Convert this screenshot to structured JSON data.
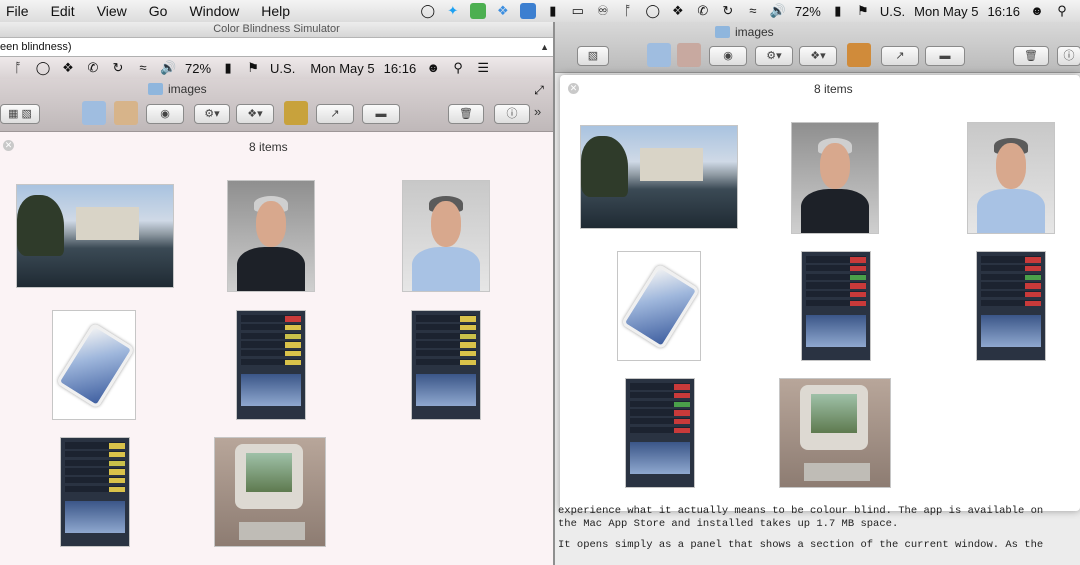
{
  "menubar": {
    "items": [
      "File",
      "Edit",
      "View",
      "Go",
      "Window",
      "Help"
    ],
    "battery": "72%",
    "input_source": "U.S.",
    "date": "Mon May 5",
    "time": "16:16",
    "colors": {
      "twitter": "#1da1f2",
      "evernote": "#4caf50",
      "dropbox": "#3d8fe0"
    }
  },
  "simulator": {
    "title": "Color Blindness Simulator",
    "mode_value": "een blindness)",
    "view": {
      "battery": "72%",
      "input_source": "U.S.",
      "date": "Mon May 5",
      "time": "16:16",
      "folder_title": "images",
      "item_count": "8 items"
    }
  },
  "finder": {
    "folder_title": "images",
    "item_count": "8 items",
    "gallery": [
      {
        "name": "alcatraz-photo",
        "kind": "photo"
      },
      {
        "name": "portrait-photo",
        "kind": "portrait"
      },
      {
        "name": "tim-cook-photo",
        "kind": "portrait"
      },
      {
        "name": "ipad-air-photo",
        "kind": "ipad"
      },
      {
        "name": "stocks-widget-photo",
        "kind": "stocks"
      },
      {
        "name": "stocks-widget-photo-2",
        "kind": "stocks"
      },
      {
        "name": "stocks-widget-photo-3",
        "kind": "stocks"
      },
      {
        "name": "imac-photo",
        "kind": "imac"
      }
    ]
  },
  "article": {
    "line1": "experience what it actually means to be colour blind. The app is available on",
    "line2": "the Mac App Store and installed takes up 1.7 MB space.",
    "line3": "It opens simply as a panel that shows a section of the current window. As the"
  }
}
